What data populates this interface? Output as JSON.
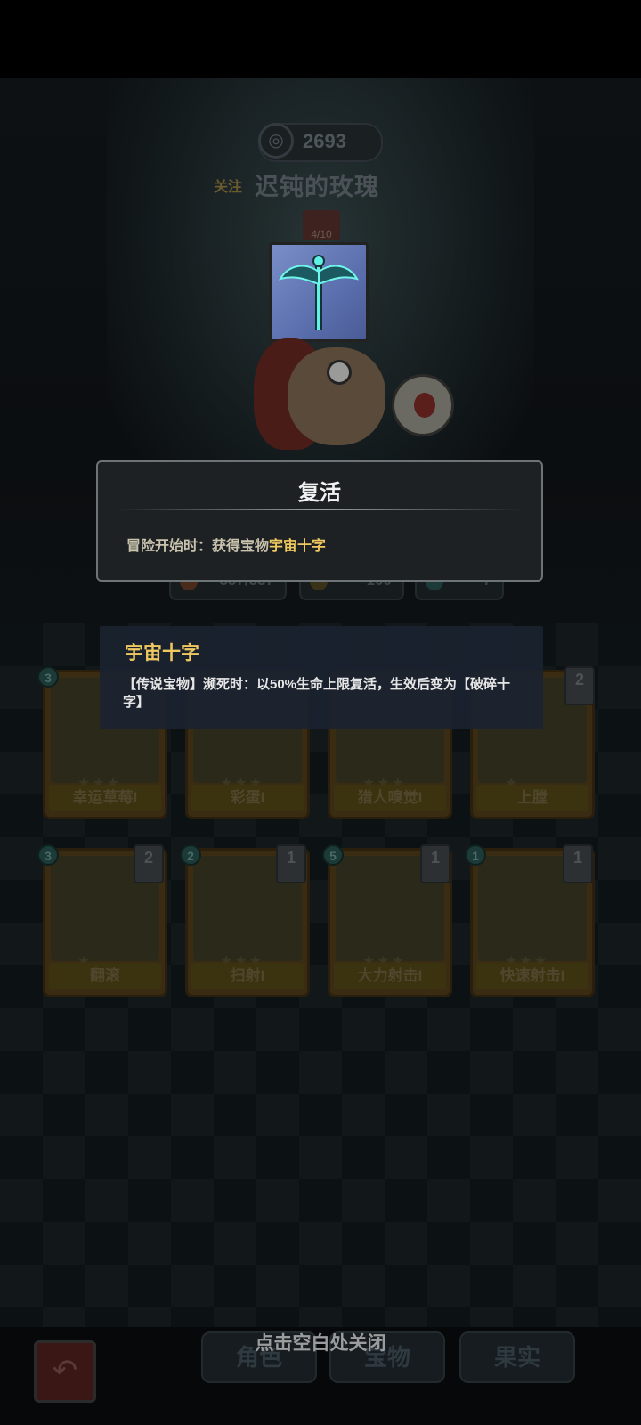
{
  "profile": {
    "score": "2693",
    "follow_label": "关注",
    "player_name": "迟钝的玫瑰",
    "level": "4/10"
  },
  "stats": [
    {
      "value": "357/357",
      "color": "#4a2a1a"
    },
    {
      "value": "100",
      "color": "#3a3216"
    },
    {
      "value": "7",
      "color": "#1d3a3a"
    }
  ],
  "skill_dialog": {
    "title": "复活",
    "desc_prefix": "冒险开始时：获得宝物",
    "desc_highlight": "宇宙十字"
  },
  "treasure_tooltip": {
    "name": "宇宙十字",
    "description": "【传说宝物】濒死时：以50%生命上限复活，生效后变为【破碎十字】"
  },
  "cards_row1": [
    {
      "name": "幸运草莓I",
      "badge": "3",
      "count": ""
    },
    {
      "name": "彩蛋I",
      "badge": "",
      "count": ""
    },
    {
      "name": "猎人嗅觉I",
      "badge": "",
      "count": ""
    },
    {
      "name": "上膛",
      "badge": "",
      "count": "2"
    }
  ],
  "cards_row2": [
    {
      "name": "翻滚",
      "badge": "3",
      "count": "2"
    },
    {
      "name": "扫射I",
      "badge": "2",
      "count": "1"
    },
    {
      "name": "大力射击I",
      "badge": "5",
      "count": "1"
    },
    {
      "name": "快速射击I",
      "badge": "1",
      "count": "1"
    }
  ],
  "bottom_tabs": [
    "角色",
    "宝物",
    "果实"
  ],
  "close_hint": "点击空白处关闭",
  "icons": {
    "back": "back-arrow-icon",
    "score": "target-icon"
  },
  "colors": {
    "highlight": "#f0c860",
    "dialog_border": "#6d7478",
    "tooltip_bg": "#1b2330"
  }
}
